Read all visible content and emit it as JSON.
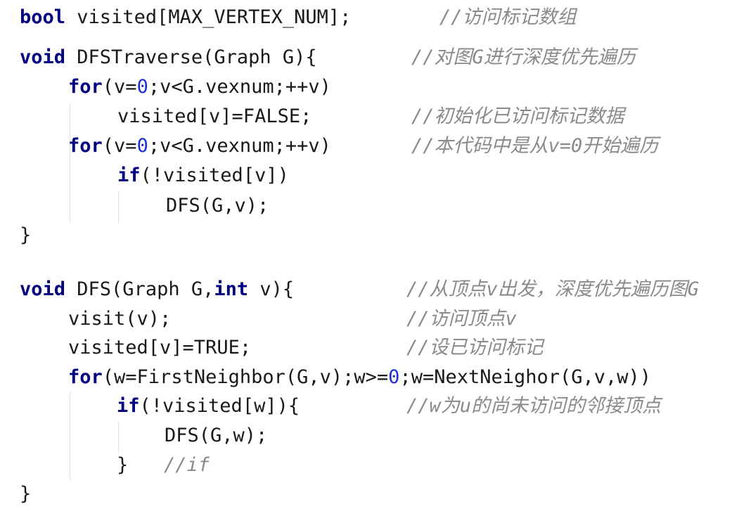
{
  "code": {
    "l1": {
      "kw": "bool",
      "rest": " visited[MAX_VERTEX_NUM];",
      "comment": "//访问标记数组"
    },
    "l2": {
      "kw": "void",
      "rest": " DFSTraverse(Graph G){",
      "comment": "//对图G进行深度优先遍历"
    },
    "l3": {
      "kw": "for",
      "a": "(v=",
      "n": "0",
      "b": ";v<G.vexnum;++v)"
    },
    "l4": {
      "text": "visited[v]=FALSE;",
      "comment": "//初始化已访问标记数据"
    },
    "l5": {
      "kw": "for",
      "a": "(v=",
      "n": "0",
      "b": ";v<G.vexnum;++v)",
      "comment": "//本代码中是从v=0开始遍历"
    },
    "l6": {
      "kw": "if",
      "rest": "(!visited[v])"
    },
    "l7": {
      "text": "DFS(G,v);"
    },
    "l8": {
      "text": "}"
    },
    "l9": {
      "kw": "void",
      "a": " DFS(Graph G,",
      "kw2": "int",
      "b": " v){",
      "comment": "//从顶点v出发，深度优先遍历图G"
    },
    "l10": {
      "text": "visit(v);",
      "comment": "//访问顶点v"
    },
    "l11": {
      "text": "visited[v]=TRUE;",
      "comment": "//设已访问标记"
    },
    "l12": {
      "kw": "for",
      "a": "(w=FirstNeighbor(G,v);w>=",
      "n": "0",
      "b": ";w=NextNeighor(G,v,w))"
    },
    "l13": {
      "kw": "if",
      "rest": "(!visited[w]){",
      "comment": "//w为u的尚未访问的邻接顶点"
    },
    "l14": {
      "text": "DFS(G,w);"
    },
    "l15": {
      "text": "}",
      "comment": "//if"
    },
    "l16": {
      "text": "}"
    }
  },
  "colors": {
    "keyword": "#000080",
    "number": "#1e2fd8",
    "comment": "#8a8a8a",
    "text": "#1a1a1a",
    "background": "#ffffff"
  }
}
